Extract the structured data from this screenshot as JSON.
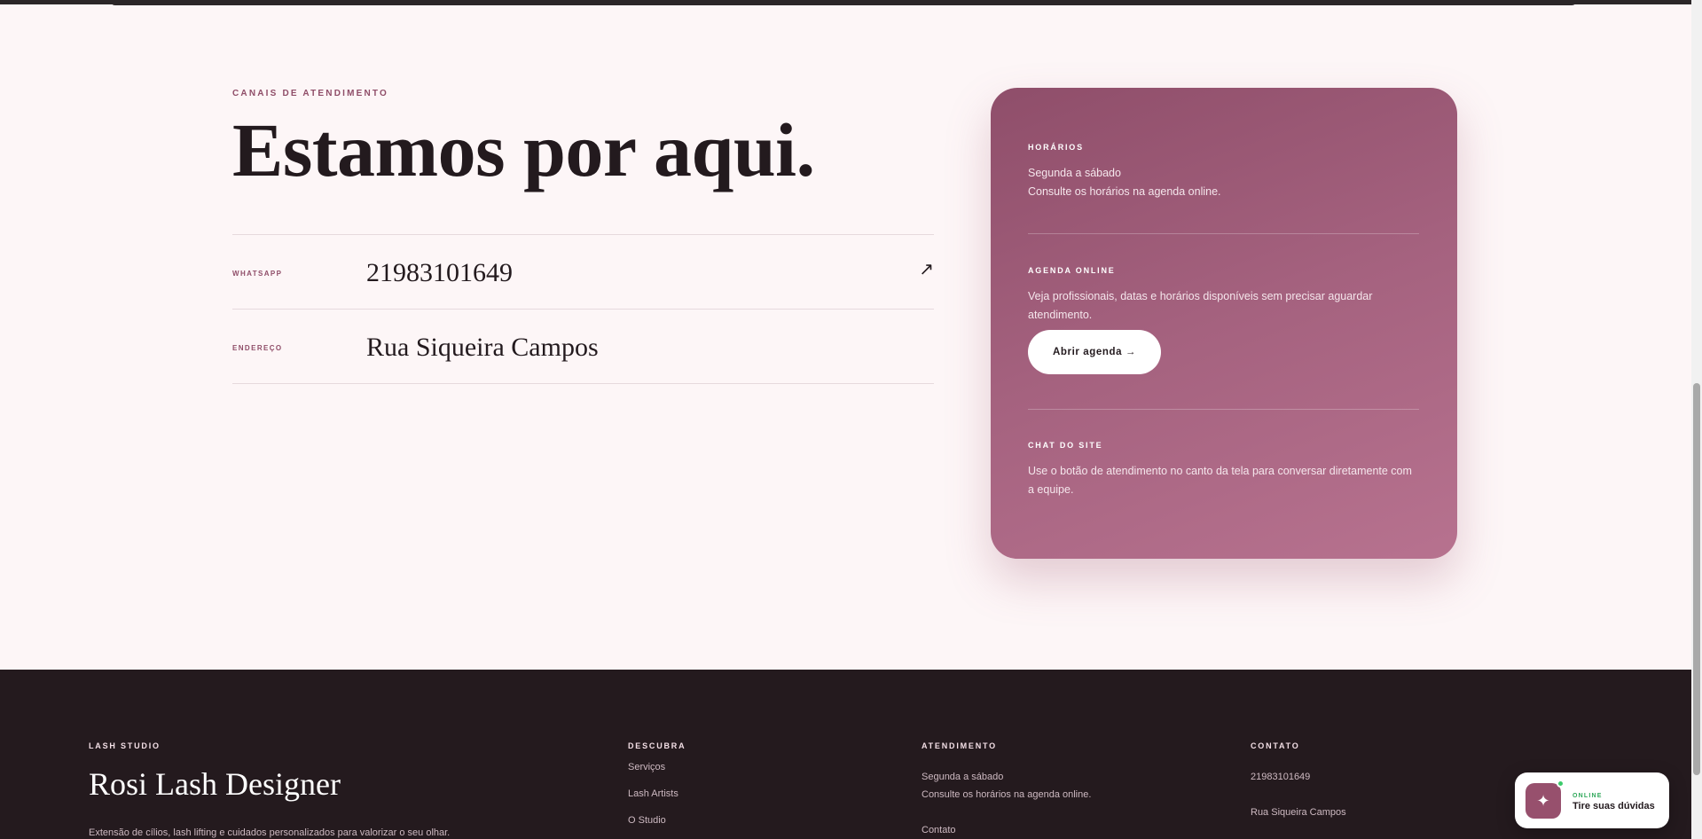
{
  "colors": {
    "page_bg": "#fdf6f7",
    "accent": "#8f4d68",
    "card_gradient_start": "#8f4e6a",
    "card_gradient_end": "#b7728f",
    "footer_bg": "#241a1e",
    "online_green": "#3ccb6b"
  },
  "contact": {
    "eyebrow": "CANAIS DE ATENDIMENTO",
    "headline": "Estamos por aqui.",
    "rows": [
      {
        "label": "WHATSAPP",
        "value": "21983101649",
        "icon": "arrow-up-right-icon"
      },
      {
        "label": "ENDEREÇO",
        "value": "Rua Siqueira Campos"
      }
    ]
  },
  "card": {
    "hours_title": "HORÁRIOS",
    "hours_line1": "Segunda a sábado",
    "hours_line2": "Consulte os horários na agenda online.",
    "agenda_title": "AGENDA ONLINE",
    "agenda_text": "Veja profissionais, datas e horários disponíveis sem precisar aguardar atendimento.",
    "agenda_button": "Abrir agenda  →",
    "chat_title": "CHAT DO SITE",
    "chat_text": "Use o botão de atendimento no canto da tela para conversar diretamente com a equipe."
  },
  "footer": {
    "brand_eyebrow": "LASH STUDIO",
    "brand_name": "Rosi Lash Designer",
    "brand_desc": "Extensão de cílios, lash lifting e cuidados personalizados para valorizar o seu olhar.",
    "discover_title": "DESCUBRA",
    "discover_links": [
      "Serviços",
      "Lash Artists",
      "O Studio"
    ],
    "service_title": "ATENDIMENTO",
    "service_line1": "Segunda a sábado",
    "service_line2": "Consulte os horários na agenda online.",
    "service_contact": "Contato",
    "contact_title": "CONTATO",
    "contact_phone": "21983101649",
    "contact_address": "Rua Siqueira Campos"
  },
  "chat_widget": {
    "icon": "sparkle-icon",
    "status": "ONLINE",
    "prompt": "Tire suas dúvidas"
  }
}
